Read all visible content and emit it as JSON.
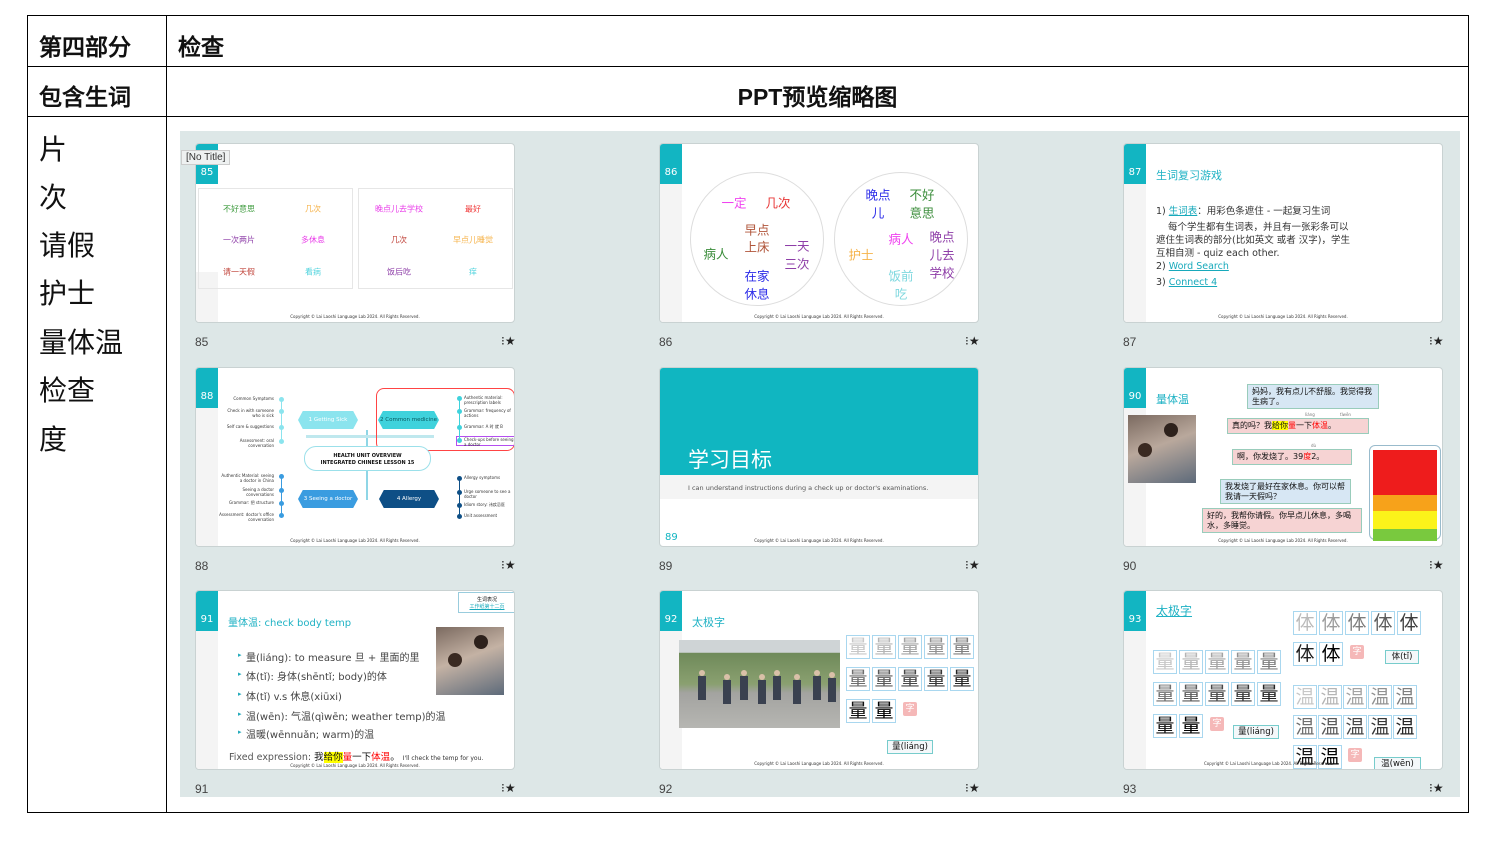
{
  "header": {
    "section_label": "第四部分",
    "section_value": "检查",
    "vocab_label": "包含生词",
    "preview_label": "PPT预览缩略图"
  },
  "vocab": [
    "片",
    "次",
    "请假",
    "护士",
    "量体温",
    "检查",
    "度"
  ],
  "copyright": "Copyright © Lai Laoshi Language Lab 2024. All Rights Reserved.",
  "star_icon": "star-icon",
  "accent": "#12b5c2",
  "slides": {
    "s85": {
      "num": "85",
      "tooltip": "[No Title]",
      "left": [
        {
          "t": "不好意思",
          "c": "#3b9a3b"
        },
        {
          "t": "几次",
          "c": "#f6b34a"
        },
        {
          "t": "一次两片",
          "c": "#8e3ea8"
        },
        {
          "t": "多休息",
          "c": "#e93be9"
        },
        {
          "t": "请一天假",
          "c": "#c0433a"
        },
        {
          "t": "看病",
          "c": "#4fd3dd"
        }
      ],
      "right": [
        {
          "t": "晚点儿去学校",
          "c": "#e93be9"
        },
        {
          "t": "最好",
          "c": "#f03a3a"
        },
        {
          "t": "几次",
          "c": "#c0433a"
        },
        {
          "t": "早点儿睡觉",
          "c": "#f6b34a"
        },
        {
          "t": "饭后吃",
          "c": "#8e3ea8"
        },
        {
          "t": "痒",
          "c": "#4fd3dd"
        }
      ]
    },
    "s86": {
      "num": "86",
      "left": [
        {
          "t": "一定",
          "c": "#f043f0"
        },
        {
          "t": "几次",
          "c": "#e83535"
        },
        {
          "t": "早点",
          "c": "#b0553a"
        },
        {
          "t": "上床",
          "c": "#b0553a"
        },
        {
          "t": "病人",
          "c": "#3b8d3b"
        },
        {
          "t": "一天",
          "c": "#8e3ea8"
        },
        {
          "t": "三次",
          "c": "#8e3ea8"
        },
        {
          "t": "在家",
          "c": "#2a2ae8"
        },
        {
          "t": "休息",
          "c": "#2a2ae8"
        }
      ],
      "right": [
        {
          "t": "晚点",
          "c": "#2a2ae8"
        },
        {
          "t": "儿",
          "c": "#2a2ae8"
        },
        {
          "t": "不好",
          "c": "#3b8d3b"
        },
        {
          "t": "意思",
          "c": "#3b8d3b"
        },
        {
          "t": "病人",
          "c": "#f043f0"
        },
        {
          "t": "晚点",
          "c": "#8e3ea8"
        },
        {
          "t": "儿去",
          "c": "#8e3ea8"
        },
        {
          "t": "学校",
          "c": "#8e3ea8"
        },
        {
          "t": "护士",
          "c": "#f6b34a"
        },
        {
          "t": "饭前",
          "c": "#7fd8df"
        },
        {
          "t": "吃",
          "c": "#7fd8df"
        }
      ]
    },
    "s87": {
      "num": "87",
      "title": "生词复习游戏",
      "l1_pre": "1) ",
      "l1_link": "生词表",
      "l1_post": "：用彩色条遮住 - 一起复习生词",
      "l2": "每个学生都有生词表，并且有一张彩条可以",
      "l3": "遮住生词表的部分(比如英文 或者 汉字)，学生",
      "l4": "互相自测 - quiz each other.",
      "l5_pre": "2) ",
      "l5_link": "Word Search",
      "l6_pre": "3) ",
      "l6_link": "Connect 4"
    },
    "s88": {
      "num": "88",
      "center1": "HEALTH UNIT OVERVIEW",
      "center2": "INTEGRATED CHINESE LESSON 15",
      "n1": "1  Getting Sick",
      "n2": "2  Common medicine",
      "n3": "3  Seeing a doctor",
      "n4": "4  Allergy",
      "tl": [
        "Common Symptoms",
        "Check in with someone who is sick",
        "Self care & suggestions",
        "Assessment: oral conversation"
      ],
      "tr": [
        "Authentic material: prescription labels",
        "Grammar: frequency of actions",
        "Grammar: A 时 就 B",
        "Check-ups before seeing a doctor"
      ],
      "bl": [
        "Authentic Material: seeing a doctor in China",
        "Seeing a doctor conversations",
        "Grammar: 把 structure",
        "Assessment: doctor's office conversation"
      ],
      "br": [
        "Allergy symptoms",
        "Urge someone to see a doctor",
        "Idiom story: 讳疾忌医",
        "Unit assessment"
      ]
    },
    "s89": {
      "num": "89",
      "title": "学习目标",
      "objective": "I can understand instructions during a check up or doctor's examinations."
    },
    "s90": {
      "num": "90",
      "title": "量体温",
      "b1": "妈妈，我有点儿不舒服。我觉得我生病了。",
      "b2_a": "真的吗？我",
      "b2_hl": "给你",
      "b2_r1": "量",
      "b2_b": "一下",
      "b2_r2": "体温",
      "b2_c": "。",
      "py1": "liáng",
      "py2": "tǐwēn",
      "b3_a": "啊，你发烧了。39",
      "b3_r": "度",
      "b3_b": "2。",
      "py3": "dù",
      "b4": "我发烧了最好在家休息。你可以帮我请一天假吗？",
      "b5": "好的，我帮你请假。你早点儿休息，多喝水，多睡觉。",
      "chart_colors": [
        "#ee1c1c",
        "#f7a21a",
        "#fbf31a",
        "#79c93e"
      ]
    },
    "s91": {
      "num": "91",
      "title": "量体温: check body temp",
      "box1": "生词表况",
      "box2": "工作纸第十二页",
      "bullets": [
        "量(liáng): to measure   旦 + 里面的里",
        "体(tǐ): 身体(shēntǐ; body)的体",
        "          体(tǐ)  v.s  休息(xiūxi)",
        "温(wēn): 气温(qìwēn; weather temp)的温",
        "           温暖(wēnnuǎn; warm)的温"
      ],
      "fx_label": "Fixed expression: ",
      "fx_a": "我",
      "fx_hl": "给你",
      "fx_r1": "量",
      "fx_b": "一下",
      "fx_r2": "体温",
      "fx_c": "。",
      "fx_en": "I'll check the temp for you."
    },
    "s92": {
      "num": "92",
      "title": "太极字",
      "char": "量",
      "tag": "量(liáng)",
      "zi": "字"
    },
    "s93": {
      "num": "93",
      "title": "太极字",
      "c1": "量",
      "c2": "体",
      "c3": "温",
      "tag1": "量(liáng)",
      "tag2": "体(tǐ)",
      "tag3": "温(wēn)",
      "zi": "字"
    }
  }
}
